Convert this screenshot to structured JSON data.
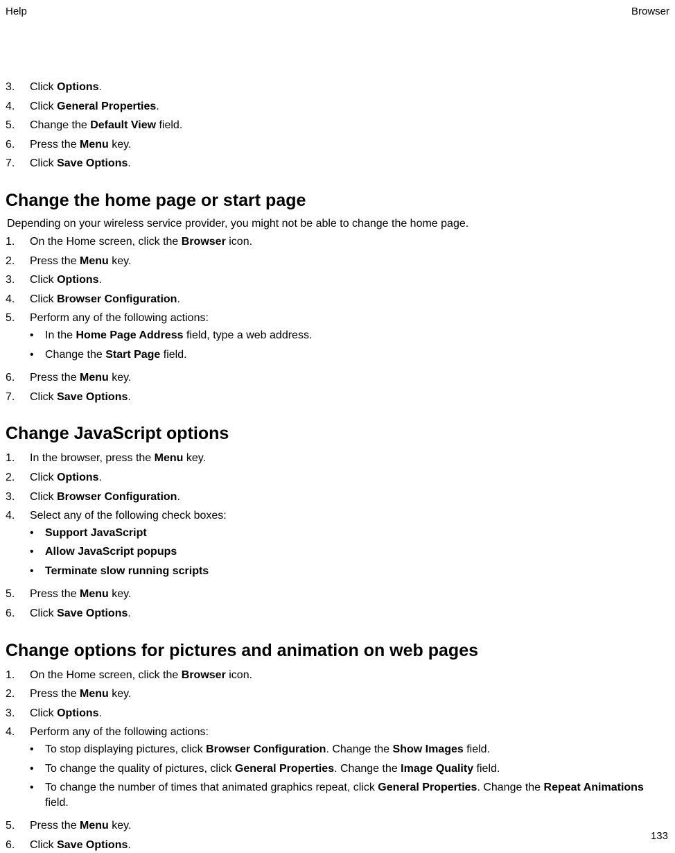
{
  "header": {
    "left": "Help",
    "right": "Browser"
  },
  "pageNumber": "133",
  "sections": [
    {
      "heading": null,
      "intro": null,
      "items": [
        {
          "num": "3.",
          "parts": [
            {
              "t": "Click "
            },
            {
              "b": "Options"
            },
            {
              "t": "."
            }
          ]
        },
        {
          "num": "4.",
          "parts": [
            {
              "t": "Click "
            },
            {
              "b": "General Properties"
            },
            {
              "t": "."
            }
          ]
        },
        {
          "num": "5.",
          "parts": [
            {
              "t": "Change the "
            },
            {
              "b": "Default View"
            },
            {
              "t": " field."
            }
          ]
        },
        {
          "num": "6.",
          "parts": [
            {
              "t": "Press the "
            },
            {
              "b": "Menu"
            },
            {
              "t": " key."
            }
          ]
        },
        {
          "num": "7.",
          "parts": [
            {
              "t": "Click "
            },
            {
              "b": "Save Options"
            },
            {
              "t": "."
            }
          ]
        }
      ]
    },
    {
      "heading": "Change the home page or start page",
      "intro": "Depending on your wireless service provider, you might not be able to change the home page.",
      "items": [
        {
          "num": "1.",
          "parts": [
            {
              "t": "On the Home screen, click the "
            },
            {
              "b": "Browser"
            },
            {
              "t": " icon."
            }
          ]
        },
        {
          "num": "2.",
          "parts": [
            {
              "t": "Press the "
            },
            {
              "b": "Menu"
            },
            {
              "t": " key."
            }
          ]
        },
        {
          "num": "3.",
          "parts": [
            {
              "t": "Click "
            },
            {
              "b": "Options"
            },
            {
              "t": "."
            }
          ]
        },
        {
          "num": "4.",
          "parts": [
            {
              "t": "Click "
            },
            {
              "b": "Browser Configuration"
            },
            {
              "t": "."
            }
          ]
        },
        {
          "num": "5.",
          "parts": [
            {
              "t": "Perform any of the following actions:"
            }
          ],
          "sub": [
            {
              "parts": [
                {
                  "t": "In the "
                },
                {
                  "b": "Home Page Address"
                },
                {
                  "t": " field, type a web address."
                }
              ]
            },
            {
              "parts": [
                {
                  "t": "Change the "
                },
                {
                  "b": "Start Page"
                },
                {
                  "t": " field."
                }
              ]
            }
          ]
        },
        {
          "num": "6.",
          "parts": [
            {
              "t": "Press the "
            },
            {
              "b": "Menu"
            },
            {
              "t": " key."
            }
          ]
        },
        {
          "num": "7.",
          "parts": [
            {
              "t": "Click "
            },
            {
              "b": "Save Options"
            },
            {
              "t": "."
            }
          ]
        }
      ]
    },
    {
      "heading": "Change JavaScript options",
      "intro": null,
      "items": [
        {
          "num": "1.",
          "parts": [
            {
              "t": "In the browser, press the "
            },
            {
              "b": "Menu"
            },
            {
              "t": " key."
            }
          ]
        },
        {
          "num": "2.",
          "parts": [
            {
              "t": "Click "
            },
            {
              "b": "Options"
            },
            {
              "t": "."
            }
          ]
        },
        {
          "num": "3.",
          "parts": [
            {
              "t": "Click "
            },
            {
              "b": "Browser Configuration"
            },
            {
              "t": "."
            }
          ]
        },
        {
          "num": "4.",
          "parts": [
            {
              "t": "Select any of the following check boxes:"
            }
          ],
          "sub": [
            {
              "parts": [
                {
                  "b": "Support JavaScript"
                }
              ]
            },
            {
              "parts": [
                {
                  "b": "Allow JavaScript popups"
                }
              ]
            },
            {
              "parts": [
                {
                  "b": "Terminate slow running scripts"
                }
              ]
            }
          ]
        },
        {
          "num": "5.",
          "parts": [
            {
              "t": "Press the "
            },
            {
              "b": "Menu"
            },
            {
              "t": " key."
            }
          ]
        },
        {
          "num": "6.",
          "parts": [
            {
              "t": "Click "
            },
            {
              "b": "Save Options"
            },
            {
              "t": "."
            }
          ]
        }
      ]
    },
    {
      "heading": "Change options for pictures and animation on web pages",
      "intro": null,
      "items": [
        {
          "num": "1.",
          "parts": [
            {
              "t": "On the Home screen, click the "
            },
            {
              "b": "Browser"
            },
            {
              "t": " icon."
            }
          ]
        },
        {
          "num": "2.",
          "parts": [
            {
              "t": "Press the "
            },
            {
              "b": "Menu"
            },
            {
              "t": " key."
            }
          ]
        },
        {
          "num": "3.",
          "parts": [
            {
              "t": "Click "
            },
            {
              "b": "Options"
            },
            {
              "t": "."
            }
          ]
        },
        {
          "num": "4.",
          "parts": [
            {
              "t": "Perform any of the following actions:"
            }
          ],
          "sub": [
            {
              "parts": [
                {
                  "t": "To stop displaying pictures, click "
                },
                {
                  "b": "Browser Configuration"
                },
                {
                  "t": ". Change the "
                },
                {
                  "b": "Show Images"
                },
                {
                  "t": " field."
                }
              ]
            },
            {
              "parts": [
                {
                  "t": "To change the quality of pictures, click "
                },
                {
                  "b": "General Properties"
                },
                {
                  "t": ". Change the "
                },
                {
                  "b": "Image Quality"
                },
                {
                  "t": " field."
                }
              ]
            },
            {
              "parts": [
                {
                  "t": "To change the number of times that animated graphics repeat, click "
                },
                {
                  "b": "General Properties"
                },
                {
                  "t": ". Change the "
                },
                {
                  "b": "Repeat Animations"
                },
                {
                  "t": " field."
                }
              ]
            }
          ]
        },
        {
          "num": "5.",
          "parts": [
            {
              "t": "Press the "
            },
            {
              "b": "Menu"
            },
            {
              "t": " key."
            }
          ]
        },
        {
          "num": "6.",
          "parts": [
            {
              "t": "Click "
            },
            {
              "b": "Save Options"
            },
            {
              "t": "."
            }
          ]
        }
      ]
    }
  ]
}
